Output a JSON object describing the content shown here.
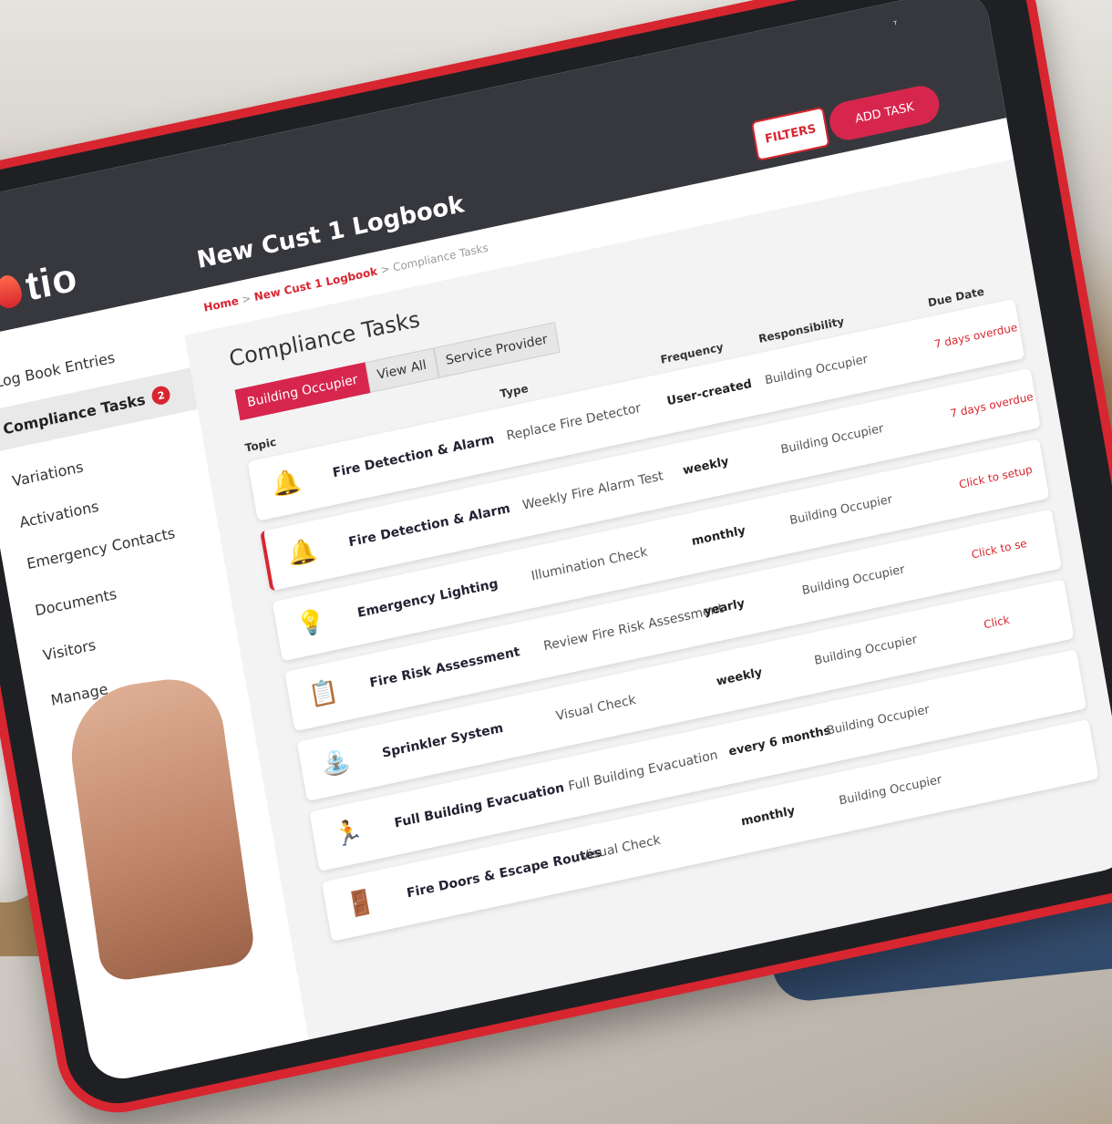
{
  "app": {
    "logo_text": "tio",
    "page_title": "New Cust 1 Logbook",
    "header_mark": "ᵀ"
  },
  "toolbar": {
    "filters_label": "FILTERS",
    "add_task_label": "ADD TASK"
  },
  "breadcrumb": {
    "home": "Home",
    "logbook": "New Cust 1 Logbook",
    "sep": ">",
    "current": "Compliance Tasks"
  },
  "sidebar": {
    "items": [
      {
        "label": "Log Book Entries"
      },
      {
        "label": "Compliance Tasks",
        "badge": "2"
      },
      {
        "label": "Variations"
      },
      {
        "label": "Activations"
      },
      {
        "label": "Emergency Contacts"
      },
      {
        "label": "Documents"
      },
      {
        "label": "Visitors"
      },
      {
        "label": "Manage"
      }
    ]
  },
  "main": {
    "title": "Compliance Tasks",
    "tabs": [
      {
        "label": "Building Occupier"
      },
      {
        "label": "View All"
      },
      {
        "label": "Service Provider"
      }
    ],
    "columns": {
      "topic": "Topic",
      "type": "Type",
      "frequency": "Frequency",
      "responsibility": "Responsibility",
      "due": "Due Date"
    },
    "rows": [
      {
        "icon": "fire-alarm-bell-icon",
        "topic": "Fire Detection & Alarm",
        "type": "Replace Fire Detector",
        "frequency": "User-created",
        "responsibility": "Building Occupier",
        "due": "7 days overdue"
      },
      {
        "icon": "fire-alarm-bell-icon",
        "topic": "Fire Detection & Alarm",
        "type": "Weekly Fire Alarm Test",
        "frequency": "weekly",
        "responsibility": "Building Occupier",
        "due": "7 days overdue"
      },
      {
        "icon": "lightbulb-icon",
        "topic": "Emergency Lighting",
        "type": "Illumination Check",
        "frequency": "monthly",
        "responsibility": "Building Occupier",
        "due": "Click to setup"
      },
      {
        "icon": "clipboard-checklist-icon",
        "topic": "Fire Risk Assessment",
        "type": "Review Fire Risk Assessment",
        "frequency": "yearly",
        "responsibility": "Building Occupier",
        "due": "Click to se"
      },
      {
        "icon": "sprinkler-icon",
        "topic": "Sprinkler System",
        "type": "Visual Check",
        "frequency": "weekly",
        "responsibility": "Building Occupier",
        "due": "Click"
      },
      {
        "icon": "exit-door-runner-icon",
        "topic": "Full Building Evacuation",
        "type": "Full Building Evacuation",
        "frequency": "every 6 months",
        "responsibility": "Building Occupier",
        "due": ""
      },
      {
        "icon": "door-panel-icon",
        "topic": "Fire Doors & Escape Routes",
        "type": "Visual Check",
        "frequency": "monthly",
        "responsibility": "Building Occupier",
        "due": ""
      }
    ]
  },
  "colors": {
    "accent": "#d7262f",
    "accent_pink": "#d7264d",
    "header_bg": "#37383d"
  }
}
